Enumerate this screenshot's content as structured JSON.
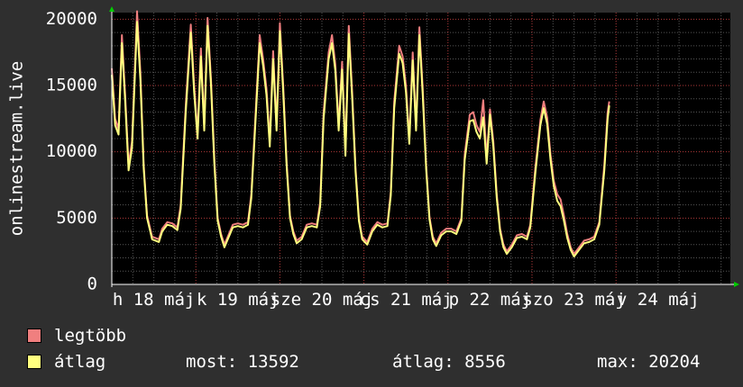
{
  "colors": {
    "background": "#2f2f2f",
    "plot_bg": "#000000",
    "max_series": "#f07f7f",
    "avg_series": "#ffff7f",
    "grid_major": "#b03a3a",
    "grid_minor": "#555555"
  },
  "legend": {
    "max_label": "legtöbb",
    "avg_label": "átlag"
  },
  "stats": {
    "current": "most: 13592",
    "average": "átlag: 8556",
    "maximum": "max: 20204"
  },
  "chart_data": {
    "type": "line",
    "title": "",
    "xlabel": "",
    "ylabel": "onlinestream.live",
    "ylim": [
      0,
      20500
    ],
    "yticks": [
      "0",
      "5000",
      "10000",
      "15000",
      "20000"
    ],
    "xticks": [
      "h 18 máj",
      "k 19 máj",
      "sze 20 máj",
      "cs 21 máj",
      "p 22 máj",
      "szo 23 máj",
      "v 24 máj"
    ],
    "grid": true,
    "legend_position": "bottom-left",
    "x_start_day": "h 18 máj",
    "x_days": 6.9,
    "series": [
      {
        "name": "legtöbb",
        "points": [
          [
            0.0,
            16300
          ],
          [
            0.04,
            12500
          ],
          [
            0.08,
            11700
          ],
          [
            0.12,
            18800
          ],
          [
            0.16,
            14200
          ],
          [
            0.2,
            9000
          ],
          [
            0.24,
            10800
          ],
          [
            0.3,
            20600
          ],
          [
            0.34,
            16000
          ],
          [
            0.38,
            9000
          ],
          [
            0.42,
            5200
          ],
          [
            0.48,
            3600
          ],
          [
            0.52,
            3500
          ],
          [
            0.56,
            3400
          ],
          [
            0.6,
            4200
          ],
          [
            0.66,
            4700
          ],
          [
            0.72,
            4600
          ],
          [
            0.78,
            4300
          ],
          [
            0.82,
            6000
          ],
          [
            0.88,
            13500
          ],
          [
            0.94,
            19600
          ],
          [
            0.98,
            15000
          ],
          [
            1.02,
            11400
          ],
          [
            1.06,
            17800
          ],
          [
            1.1,
            12000
          ],
          [
            1.14,
            20100
          ],
          [
            1.18,
            15500
          ],
          [
            1.22,
            9500
          ],
          [
            1.26,
            5000
          ],
          [
            1.3,
            3800
          ],
          [
            1.34,
            3000
          ],
          [
            1.38,
            3600
          ],
          [
            1.44,
            4500
          ],
          [
            1.5,
            4600
          ],
          [
            1.56,
            4500
          ],
          [
            1.62,
            4700
          ],
          [
            1.66,
            6800
          ],
          [
            1.72,
            14000
          ],
          [
            1.76,
            18800
          ],
          [
            1.8,
            17000
          ],
          [
            1.84,
            14800
          ],
          [
            1.88,
            10800
          ],
          [
            1.92,
            17600
          ],
          [
            1.96,
            12000
          ],
          [
            2.0,
            19700
          ],
          [
            2.04,
            15000
          ],
          [
            2.08,
            9200
          ],
          [
            2.12,
            5200
          ],
          [
            2.16,
            4000
          ],
          [
            2.2,
            3300
          ],
          [
            2.26,
            3600
          ],
          [
            2.32,
            4500
          ],
          [
            2.38,
            4600
          ],
          [
            2.44,
            4500
          ],
          [
            2.48,
            6200
          ],
          [
            2.52,
            13000
          ],
          [
            2.58,
            17500
          ],
          [
            2.62,
            18800
          ],
          [
            2.66,
            16600
          ],
          [
            2.7,
            12000
          ],
          [
            2.74,
            16800
          ],
          [
            2.78,
            10000
          ],
          [
            2.82,
            19500
          ],
          [
            2.86,
            14500
          ],
          [
            2.9,
            8800
          ],
          [
            2.94,
            5000
          ],
          [
            2.98,
            3600
          ],
          [
            3.04,
            3200
          ],
          [
            3.1,
            4200
          ],
          [
            3.16,
            4700
          ],
          [
            3.22,
            4500
          ],
          [
            3.28,
            4600
          ],
          [
            3.32,
            7000
          ],
          [
            3.36,
            13800
          ],
          [
            3.42,
            18000
          ],
          [
            3.46,
            17200
          ],
          [
            3.5,
            15000
          ],
          [
            3.54,
            11000
          ],
          [
            3.58,
            17500
          ],
          [
            3.62,
            12000
          ],
          [
            3.66,
            19400
          ],
          [
            3.7,
            14800
          ],
          [
            3.74,
            9000
          ],
          [
            3.78,
            5100
          ],
          [
            3.82,
            3600
          ],
          [
            3.86,
            3100
          ],
          [
            3.92,
            3900
          ],
          [
            3.98,
            4200
          ],
          [
            4.04,
            4200
          ],
          [
            4.1,
            4000
          ],
          [
            4.16,
            5000
          ],
          [
            4.2,
            9800
          ],
          [
            4.26,
            12800
          ],
          [
            4.3,
            13000
          ],
          [
            4.34,
            12000
          ],
          [
            4.38,
            11500
          ],
          [
            4.42,
            13900
          ],
          [
            4.46,
            9500
          ],
          [
            4.5,
            13200
          ],
          [
            4.54,
            10800
          ],
          [
            4.58,
            6800
          ],
          [
            4.62,
            4200
          ],
          [
            4.66,
            3000
          ],
          [
            4.7,
            2500
          ],
          [
            4.76,
            3000
          ],
          [
            4.82,
            3700
          ],
          [
            4.88,
            3800
          ],
          [
            4.94,
            3600
          ],
          [
            4.98,
            4500
          ],
          [
            5.04,
            8800
          ],
          [
            5.1,
            12400
          ],
          [
            5.14,
            13800
          ],
          [
            5.18,
            12600
          ],
          [
            5.22,
            9800
          ],
          [
            5.26,
            7800
          ],
          [
            5.3,
            6800
          ],
          [
            5.34,
            6400
          ],
          [
            5.38,
            5200
          ],
          [
            5.42,
            3800
          ],
          [
            5.46,
            2800
          ],
          [
            5.5,
            2300
          ],
          [
            5.56,
            2800
          ],
          [
            5.62,
            3300
          ],
          [
            5.68,
            3400
          ],
          [
            5.74,
            3600
          ],
          [
            5.8,
            4700
          ],
          [
            5.86,
            9000
          ],
          [
            5.9,
            13000
          ],
          [
            5.92,
            13800
          ]
        ]
      },
      {
        "name": "átlag",
        "points": [
          [
            0.0,
            15800
          ],
          [
            0.04,
            12000
          ],
          [
            0.08,
            11300
          ],
          [
            0.12,
            18200
          ],
          [
            0.16,
            13700
          ],
          [
            0.2,
            8600
          ],
          [
            0.24,
            10300
          ],
          [
            0.3,
            19800
          ],
          [
            0.34,
            15400
          ],
          [
            0.38,
            8700
          ],
          [
            0.42,
            5000
          ],
          [
            0.48,
            3400
          ],
          [
            0.52,
            3300
          ],
          [
            0.56,
            3200
          ],
          [
            0.6,
            4000
          ],
          [
            0.66,
            4500
          ],
          [
            0.72,
            4400
          ],
          [
            0.78,
            4100
          ],
          [
            0.82,
            5700
          ],
          [
            0.88,
            13000
          ],
          [
            0.94,
            19000
          ],
          [
            0.98,
            14500
          ],
          [
            1.02,
            11000
          ],
          [
            1.06,
            17200
          ],
          [
            1.1,
            11600
          ],
          [
            1.14,
            19500
          ],
          [
            1.18,
            15000
          ],
          [
            1.22,
            9100
          ],
          [
            1.26,
            4800
          ],
          [
            1.3,
            3600
          ],
          [
            1.34,
            2800
          ],
          [
            1.38,
            3400
          ],
          [
            1.44,
            4300
          ],
          [
            1.5,
            4400
          ],
          [
            1.56,
            4300
          ],
          [
            1.62,
            4500
          ],
          [
            1.66,
            6500
          ],
          [
            1.72,
            13500
          ],
          [
            1.76,
            18200
          ],
          [
            1.8,
            16500
          ],
          [
            1.84,
            14300
          ],
          [
            1.88,
            10400
          ],
          [
            1.92,
            17000
          ],
          [
            1.96,
            11600
          ],
          [
            2.0,
            19100
          ],
          [
            2.04,
            14500
          ],
          [
            2.08,
            8900
          ],
          [
            2.12,
            5000
          ],
          [
            2.16,
            3800
          ],
          [
            2.2,
            3100
          ],
          [
            2.26,
            3400
          ],
          [
            2.32,
            4300
          ],
          [
            2.38,
            4400
          ],
          [
            2.44,
            4300
          ],
          [
            2.48,
            5900
          ],
          [
            2.52,
            12500
          ],
          [
            2.58,
            17000
          ],
          [
            2.62,
            18200
          ],
          [
            2.66,
            16100
          ],
          [
            2.7,
            11600
          ],
          [
            2.74,
            16200
          ],
          [
            2.78,
            9700
          ],
          [
            2.82,
            18900
          ],
          [
            2.86,
            14000
          ],
          [
            2.9,
            8500
          ],
          [
            2.94,
            4800
          ],
          [
            2.98,
            3400
          ],
          [
            3.04,
            3000
          ],
          [
            3.1,
            4000
          ],
          [
            3.16,
            4500
          ],
          [
            3.22,
            4300
          ],
          [
            3.28,
            4400
          ],
          [
            3.32,
            6700
          ],
          [
            3.36,
            13300
          ],
          [
            3.42,
            17400
          ],
          [
            3.46,
            16700
          ],
          [
            3.5,
            14500
          ],
          [
            3.54,
            10600
          ],
          [
            3.58,
            16900
          ],
          [
            3.62,
            11600
          ],
          [
            3.66,
            18800
          ],
          [
            3.7,
            14300
          ],
          [
            3.74,
            8700
          ],
          [
            3.78,
            4900
          ],
          [
            3.82,
            3400
          ],
          [
            3.86,
            2900
          ],
          [
            3.92,
            3700
          ],
          [
            3.98,
            4000
          ],
          [
            4.04,
            4000
          ],
          [
            4.1,
            3800
          ],
          [
            4.16,
            4800
          ],
          [
            4.2,
            9400
          ],
          [
            4.26,
            12300
          ],
          [
            4.3,
            12400
          ],
          [
            4.34,
            11500
          ],
          [
            4.38,
            11000
          ],
          [
            4.42,
            12600
          ],
          [
            4.46,
            9100
          ],
          [
            4.5,
            12800
          ],
          [
            4.54,
            10400
          ],
          [
            4.58,
            6500
          ],
          [
            4.62,
            4000
          ],
          [
            4.66,
            2800
          ],
          [
            4.7,
            2300
          ],
          [
            4.76,
            2800
          ],
          [
            4.82,
            3500
          ],
          [
            4.88,
            3600
          ],
          [
            4.94,
            3400
          ],
          [
            4.98,
            4300
          ],
          [
            5.04,
            8400
          ],
          [
            5.1,
            12000
          ],
          [
            5.14,
            13300
          ],
          [
            5.18,
            12100
          ],
          [
            5.22,
            9400
          ],
          [
            5.26,
            7400
          ],
          [
            5.3,
            6300
          ],
          [
            5.34,
            5900
          ],
          [
            5.38,
            4800
          ],
          [
            5.42,
            3500
          ],
          [
            5.46,
            2600
          ],
          [
            5.5,
            2100
          ],
          [
            5.56,
            2600
          ],
          [
            5.62,
            3100
          ],
          [
            5.68,
            3200
          ],
          [
            5.74,
            3400
          ],
          [
            5.8,
            4500
          ],
          [
            5.86,
            8600
          ],
          [
            5.9,
            12500
          ],
          [
            5.92,
            13500
          ]
        ]
      }
    ]
  }
}
